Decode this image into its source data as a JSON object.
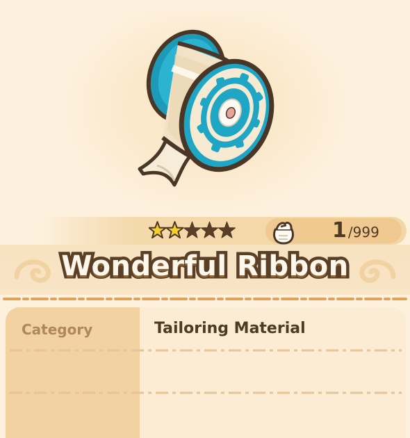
{
  "item": {
    "name": "Wonderful Ribbon",
    "icon": "ribbon-spool-icon",
    "rarity": {
      "filled": 2,
      "max": 5
    },
    "quantity": {
      "owned": "1",
      "max": "/999"
    }
  },
  "details": {
    "rows": [
      {
        "label": "Category",
        "value": "Tailoring Material"
      },
      {
        "label": "",
        "value": ""
      },
      {
        "label": "",
        "value": ""
      }
    ]
  },
  "colors": {
    "background": "#fdf0dc",
    "star_filled": "#f6d02a",
    "star_empty": "#5a3f26",
    "ribbon_teal": "#1fa6c4",
    "title_outline": "#5a3f26"
  }
}
